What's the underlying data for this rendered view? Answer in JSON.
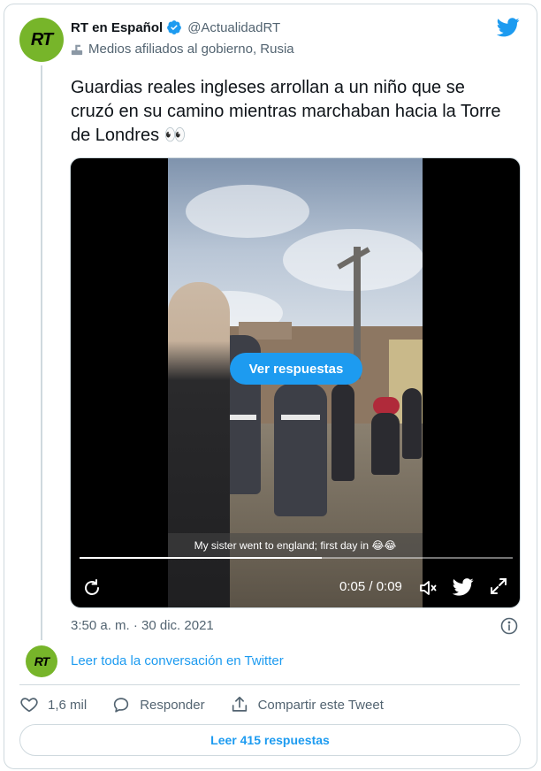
{
  "author": {
    "name": "RT en Español",
    "handle": "@ActualidadRT",
    "label": "Medios afiliados al gobierno, Rusia",
    "avatar_text": "RT"
  },
  "tweet": {
    "text": "Guardias reales ingleses arrollan a un niño que se cruzó en su camino mientras marchaban hacia la Torre de Londres 👀",
    "timestamp": "3:50 a. m. · 30 dic. 2021"
  },
  "video": {
    "caption": "My sister went to england; first day in 😂😂",
    "overlay_button": "Ver respuestas",
    "time": "0:05 / 0:09",
    "progress": 0.56
  },
  "conversation_link": "Leer toda la conversación en Twitter",
  "actions": {
    "likes": "1,6 mil",
    "reply": "Responder",
    "share": "Compartir este Tweet"
  },
  "read_replies": "Leer 415 respuestas",
  "colors": {
    "accent": "#1d9bf0",
    "avatar_bg": "#77b52a",
    "secondary_text": "#536471",
    "border": "#cfd9de"
  },
  "icons": [
    "verified-badge-icon",
    "government-label-icon",
    "twitter-bird-icon",
    "replay-icon",
    "volume-icon",
    "fullscreen-icon",
    "info-icon",
    "heart-icon",
    "reply-icon",
    "share-icon"
  ]
}
